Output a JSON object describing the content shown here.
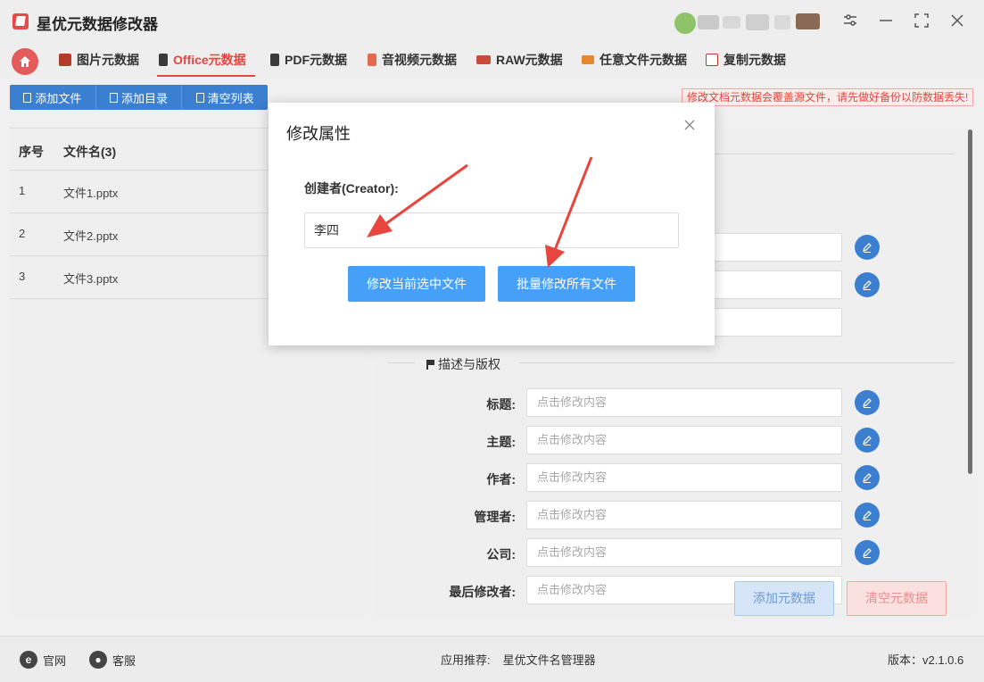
{
  "app": {
    "title": "星优元数据修改器"
  },
  "tabs": [
    {
      "label": "图片元数据",
      "icon": "image-icon",
      "color": "#c0392b",
      "active": false
    },
    {
      "label": "Office元数据",
      "icon": "office-icon",
      "color": "#333333",
      "active": true
    },
    {
      "label": "PDF元数据",
      "icon": "pdf-icon",
      "color": "#333333",
      "active": false
    },
    {
      "label": "音视频元数据",
      "icon": "media-icon",
      "color": "#d9534f",
      "active": false
    },
    {
      "label": "RAW元数据",
      "icon": "raw-icon",
      "color": "#d9534f",
      "active": false
    },
    {
      "label": "任意文件元数据",
      "icon": "any-file-icon",
      "color": "#e67e22",
      "active": false
    },
    {
      "label": "复制元数据",
      "icon": "copy-icon",
      "color": "#c0392b",
      "active": false
    }
  ],
  "toolbar": {
    "add_file": "添加文件",
    "add_dir": "添加目录",
    "clear_list": "清空列表"
  },
  "warning": "修改文档元数据会覆盖源文件，请先做好备份以防数据丢失!",
  "file_table": {
    "col_index": "序号",
    "col_name": "文件名(3)",
    "rows": [
      {
        "index": "1",
        "name": "文件1.pptx"
      },
      {
        "index": "2",
        "name": "文件2.pptx"
      },
      {
        "index": "3",
        "name": "文件3.pptx"
      }
    ]
  },
  "props": {
    "section_title": "描述与版权",
    "placeholder": "点击修改内容",
    "fields": [
      {
        "label": "标题:"
      },
      {
        "label": "主题:"
      },
      {
        "label": "作者:"
      },
      {
        "label": "管理者:"
      },
      {
        "label": "公司:"
      },
      {
        "label": "最后修改者:"
      }
    ]
  },
  "actions": {
    "add_meta": "添加元数据",
    "clear_meta": "清空元数据"
  },
  "statusbar": {
    "website": "官网",
    "support": "客服",
    "recommend_label": "应用推荐:",
    "recommend_app": "星优文件名管理器",
    "version": "版本：v2.1.0.6"
  },
  "modal": {
    "title": "修改属性",
    "field_label": "创建者(Creator):",
    "field_value": "李四",
    "btn_current": "修改当前选中文件",
    "btn_batch": "批量修改所有文件"
  },
  "colors": {
    "accent_red": "#e5463f",
    "primary_blue": "#46a0f8",
    "toolbar_blue": "#3a7fd0",
    "arrow": "#e8453f"
  }
}
